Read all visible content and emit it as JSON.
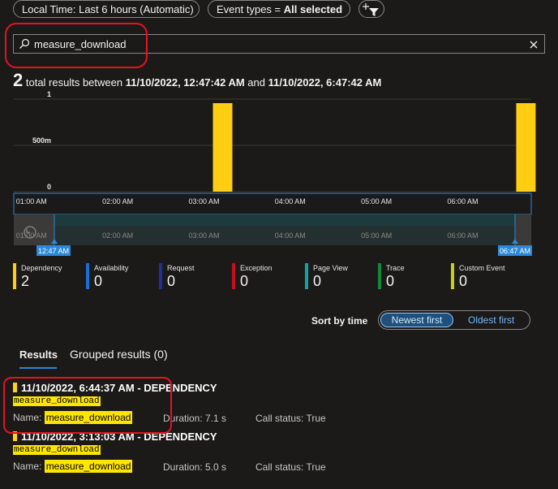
{
  "toolbar": {
    "time_range_label": "Local Time: Last 6 hours (Automatic)",
    "event_types_prefix": "Event types = ",
    "event_types_value": "All selected"
  },
  "search": {
    "value": "measure_download"
  },
  "summary": {
    "count": "2",
    "text1": " total results between ",
    "from": "11/10/2022, 12:47:42 AM",
    "text2": " and ",
    "to": "11/10/2022, 6:47:42 AM"
  },
  "chart_data": {
    "type": "bar",
    "yticks": [
      "1",
      "500m",
      "0"
    ],
    "ylim": [
      0,
      1
    ],
    "x_tick_labels": [
      "01:00 AM",
      "02:00 AM",
      "03:00 AM",
      "04:00 AM",
      "05:00 AM",
      "06:00 AM"
    ],
    "bars": [
      {
        "time": "03:13 AM",
        "value": 1
      },
      {
        "time": "06:44 AM",
        "value": 1
      }
    ],
    "bar_color": "#ffcd11",
    "range_start_label": "12:47 AM",
    "range_end_label": "06:47 AM"
  },
  "legend": [
    {
      "label": "Dependency",
      "value": "2",
      "color": "#ffcd11"
    },
    {
      "label": "Availability",
      "value": "0",
      "color": "#1a6ed8"
    },
    {
      "label": "Request",
      "value": "0",
      "color": "#1f2f9e"
    },
    {
      "label": "Exception",
      "value": "0",
      "color": "#c50f1f"
    },
    {
      "label": "Page View",
      "value": "0",
      "color": "#13a3a3"
    },
    {
      "label": "Trace",
      "value": "0",
      "color": "#10893e"
    },
    {
      "label": "Custom Event",
      "value": "0",
      "color": "#c5d10f"
    }
  ],
  "sort": {
    "label": "Sort by time",
    "newest": "Newest first",
    "oldest": "Oldest first"
  },
  "tabs": {
    "results": "Results",
    "grouped": "Grouped results (0)"
  },
  "results": [
    {
      "title": "11/10/2022, 6:44:37 AM - DEPENDENCY",
      "name_mono": "measure_download",
      "name_label": "Name: ",
      "name_value": "measure_download",
      "duration": "Duration: 7.1 s",
      "call_status": "Call status: True"
    },
    {
      "title": "11/10/2022, 3:13:03 AM - DEPENDENCY",
      "name_mono": "measure_download",
      "name_label": "Name: ",
      "name_value": "measure_download",
      "duration": "Duration: 5.0 s",
      "call_status": "Call status: True"
    }
  ]
}
